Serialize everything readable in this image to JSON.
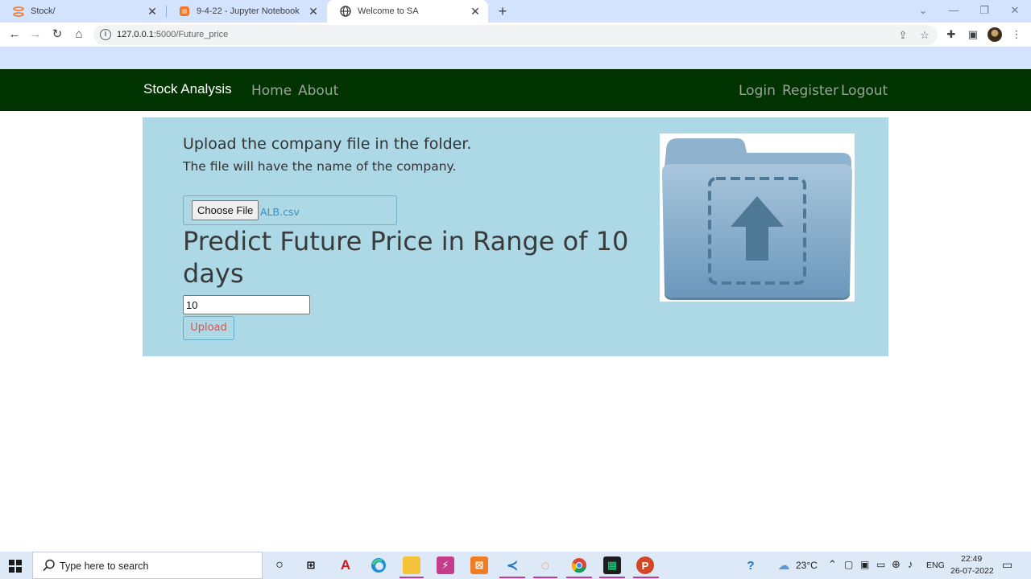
{
  "browser": {
    "tabs": [
      {
        "title": "Stock/",
        "icon": "jupyter-icon"
      },
      {
        "title": "9-4-22 - Jupyter Notebook",
        "icon": "jupyter-notebook-icon"
      },
      {
        "title": "Welcome to SA",
        "icon": "globe-icon"
      }
    ],
    "url_host": "127.0.0.1",
    "url_path": ":5000/Future_price"
  },
  "navbar": {
    "brand": "Stock Analysis",
    "home": "Home",
    "about": "About",
    "login": "Login",
    "register": "Register",
    "logout": "Logout",
    "bg_color": "#003300"
  },
  "main": {
    "heading": "Upload the company file in the folder.",
    "subheading": "The file will have the name of the company.",
    "choose_file_label": "Choose File",
    "selected_file": "ALB.csv",
    "predict_heading": "Predict Future Price in Range of 10 days",
    "days_value": "10",
    "upload_label": "Upload",
    "panel_color": "#add8e6",
    "image": "folder-upload-icon"
  },
  "taskbar": {
    "search_placeholder": "Type here to search",
    "weather": "23°C",
    "language": "ENG",
    "time": "22:49",
    "date": "26-07-2022"
  }
}
